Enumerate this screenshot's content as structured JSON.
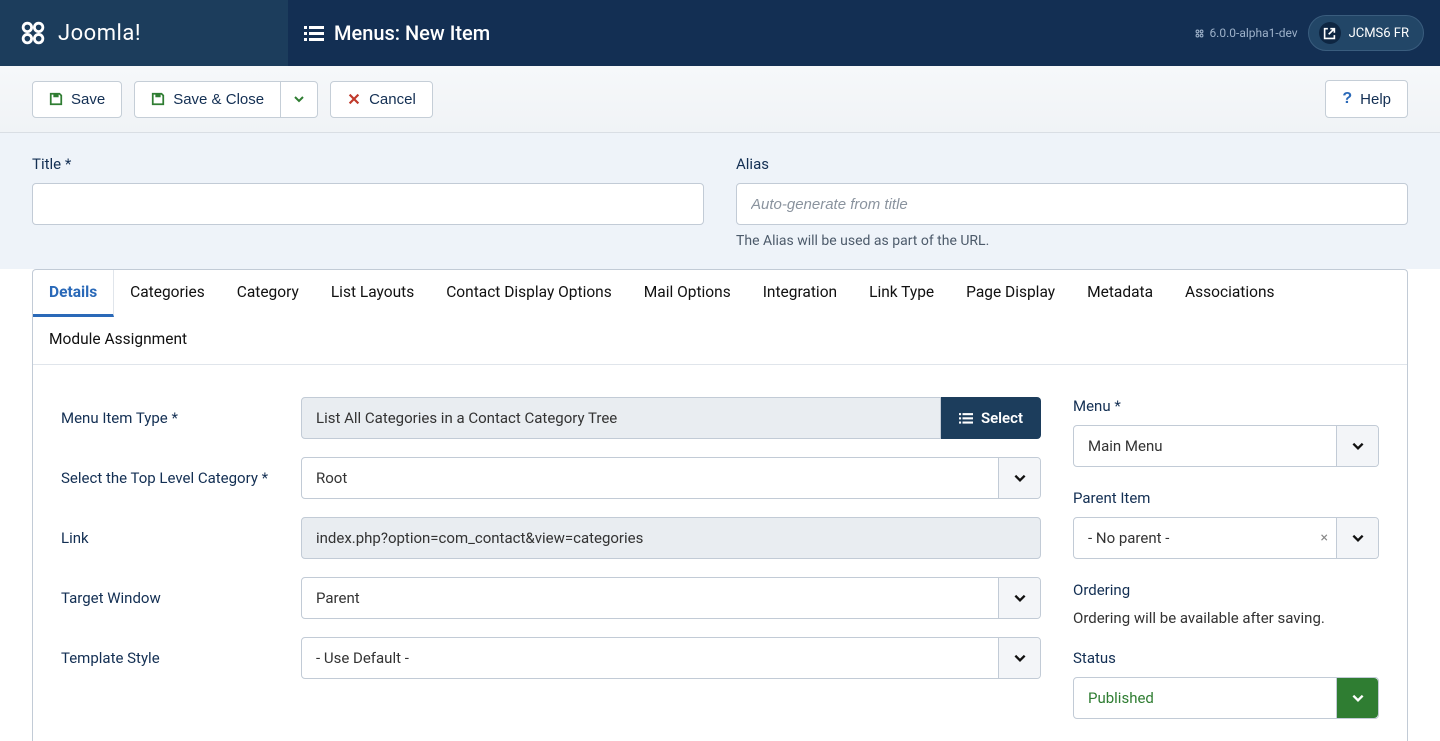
{
  "brand": "Joomla!",
  "header": {
    "title": "Menus: New Item",
    "version": "6.0.0-alpha1-dev",
    "site_btn": "JCMS6 FR"
  },
  "toolbar": {
    "save": "Save",
    "save_close": "Save & Close",
    "cancel": "Cancel",
    "help": "Help"
  },
  "head": {
    "title_label": "Title *",
    "title_value": "",
    "alias_label": "Alias",
    "alias_placeholder": "Auto-generate from title",
    "alias_help": "The Alias will be used as part of the URL."
  },
  "tabs": [
    "Details",
    "Categories",
    "Category",
    "List Layouts",
    "Contact Display Options",
    "Mail Options",
    "Integration",
    "Link Type",
    "Page Display",
    "Metadata",
    "Associations",
    "Module Assignment"
  ],
  "details": {
    "menu_item_type_label": "Menu Item Type *",
    "menu_item_type_value": "List All Categories in a Contact Category Tree",
    "select_btn": "Select",
    "top_level_label": "Select the Top Level Category *",
    "top_level_value": "Root",
    "link_label": "Link",
    "link_value": "index.php?option=com_contact&view=categories",
    "target_window_label": "Target Window",
    "target_window_value": "Parent",
    "template_style_label": "Template Style",
    "template_style_value": "- Use Default -"
  },
  "side": {
    "menu_label": "Menu *",
    "menu_value": "Main Menu",
    "parent_label": "Parent Item",
    "parent_value": "- No parent -",
    "ordering_label": "Ordering",
    "ordering_text": "Ordering will be available after saving.",
    "status_label": "Status",
    "status_value": "Published"
  }
}
